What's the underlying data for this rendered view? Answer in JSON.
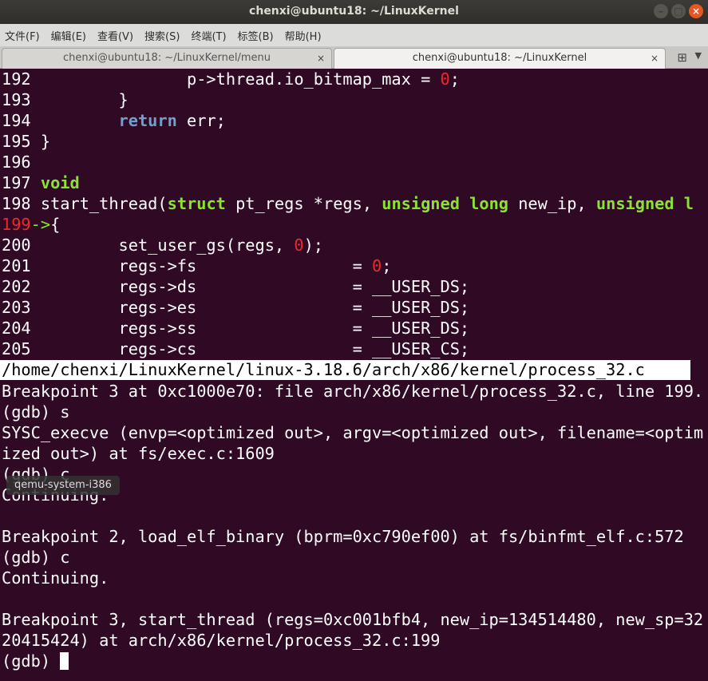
{
  "window": {
    "title": "chenxi@ubuntu18: ~/LinuxKernel",
    "controls": [
      "–",
      "□",
      "×"
    ]
  },
  "menu": [
    "文件(F)",
    "编辑(E)",
    "查看(V)",
    "搜索(S)",
    "终端(T)",
    "标签(B)",
    "帮助(H)"
  ],
  "tabs": [
    {
      "label": "chenxi@ubuntu18: ~/LinuxKernel/menu",
      "close": "×"
    },
    {
      "label": "chenxi@ubuntu18: ~/LinuxKernel",
      "close": "×"
    }
  ],
  "tabbar_icons": {
    "new_tab": "⊞",
    "menu": "▼"
  },
  "source": {
    "l192": {
      "n": "192",
      "pre": "               p->thread.io_bitmap_max = ",
      "num": "0",
      "post": ";"
    },
    "l193": {
      "n": "193",
      "text": "        }"
    },
    "l194": {
      "n": "194",
      "pre": "        ",
      "kw": "return",
      "post": " err;"
    },
    "l195": {
      "n": "195",
      "text": "}"
    },
    "l196": {
      "n": "196",
      "text": ""
    },
    "l197": {
      "n": "197",
      "type": "void"
    },
    "l198": {
      "n": "198",
      "a": "start_thread(",
      "t1": "struct",
      "b": " pt_regs *regs, ",
      "t2": "unsigned long",
      "c": " new_ip, ",
      "t3": "unsigned l"
    },
    "l199": {
      "n": "199",
      "arrow": "->",
      "text": "{"
    },
    "l200": {
      "n": "200",
      "pre": "        set_user_gs(regs, ",
      "num": "0",
      "post": ");"
    },
    "l201": {
      "n": "201",
      "pre": "        regs->fs                = ",
      "num": "0",
      "post": ";"
    },
    "l202": {
      "n": "202",
      "text": "        regs->ds                = __USER_DS;"
    },
    "l203": {
      "n": "203",
      "text": "        regs->es                = __USER_DS;"
    },
    "l204": {
      "n": "204",
      "text": "        regs->ss                = __USER_DS;"
    },
    "l205": {
      "n": "205",
      "text": "        regs->cs                = __USER_CS;"
    }
  },
  "source_path": "/home/chenxi/LinuxKernel/linux-3.18.6/arch/x86/kernel/process_32.c",
  "gdb_output": [
    "Breakpoint 3 at 0xc1000e70: file arch/x86/kernel/process_32.c, line 199.",
    "(gdb) s",
    "SYSC_execve (envp=<optimized out>, argv=<optimized out>, filename=<optim",
    "ized out>) at fs/exec.c:1609",
    "(gdb) c",
    "Continuing.",
    "",
    "Breakpoint 2, load_elf_binary (bprm=0xc790ef00) at fs/binfmt_elf.c:572",
    "(gdb) c",
    "Continuing.",
    "",
    "Breakpoint 3, start_thread (regs=0xc001bfb4, new_ip=134514480, new_sp=32",
    "20415424) at arch/x86/kernel/process_32.c:199"
  ],
  "prompt": "(gdb) ",
  "tooltip": "qemu-system-i386"
}
